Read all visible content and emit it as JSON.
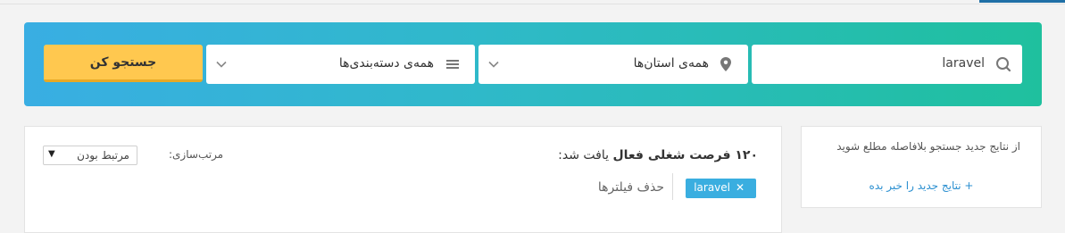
{
  "search": {
    "keyword_value": "laravel",
    "province_label": "همه‌ی استان‌ها",
    "category_label": "همه‌ی دسته‌بندی‌ها",
    "submit_label": "جستجو کن"
  },
  "results": {
    "count_prefix": "۱۲۰ فرصت شغلی فعال",
    "count_suffix": " یافت شد:",
    "sort_label": "مرتب‌سازی:",
    "sort_value": "مرتبط بودن",
    "chip_label": "laravel",
    "remove_filters": "حذف فیلترها"
  },
  "notify": {
    "text": "از نتایج جدید جستجو بلافاصله مطلع شوید",
    "link": "+ نتایج جدید را خبر بده"
  },
  "colors": {
    "accent_yellow": "#ffc84f",
    "chip_blue": "#3aaee0",
    "link_blue": "#2a8fd0"
  }
}
